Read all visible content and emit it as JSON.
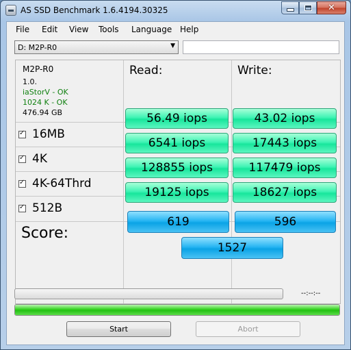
{
  "window": {
    "title": "AS SSD Benchmark 1.6.4194.30325",
    "close_symbol": "✕"
  },
  "menu": [
    "File",
    "Edit",
    "View",
    "Tools",
    "Language",
    "Help"
  ],
  "drive_selector": {
    "value": "D: M2P-R0",
    "arrow": "▼"
  },
  "drive_info": {
    "name": "M2P-R0",
    "version": "1.0.",
    "driver_status": "iaStorV - OK",
    "alignment_status": "1024 K - OK",
    "capacity": "476.94 GB"
  },
  "columns": {
    "read": "Read:",
    "write": "Write:"
  },
  "tests": [
    {
      "label": "16MB",
      "checked": true,
      "read": "56.49 iops",
      "write": "43.02 iops"
    },
    {
      "label": "4K",
      "checked": true,
      "read": "6541 iops",
      "write": "17443 iops"
    },
    {
      "label": "4K-64Thrd",
      "checked": true,
      "read": "128855 iops",
      "write": "117479 iops"
    },
    {
      "label": "512B",
      "checked": true,
      "read": "19125 iops",
      "write": "18627 iops"
    }
  ],
  "score": {
    "label": "Score:",
    "read": "619",
    "write": "596",
    "total": "1527"
  },
  "progress": {
    "timer": "--:--:--",
    "main_fraction": 1.0,
    "step_fraction": 0.0
  },
  "buttons": {
    "start": "Start",
    "abort": "Abort"
  },
  "colors": {
    "result_green": "#18e69c",
    "score_blue": "#0aa3e6",
    "ok_green": "#108010",
    "progress_green": "#24c013"
  }
}
